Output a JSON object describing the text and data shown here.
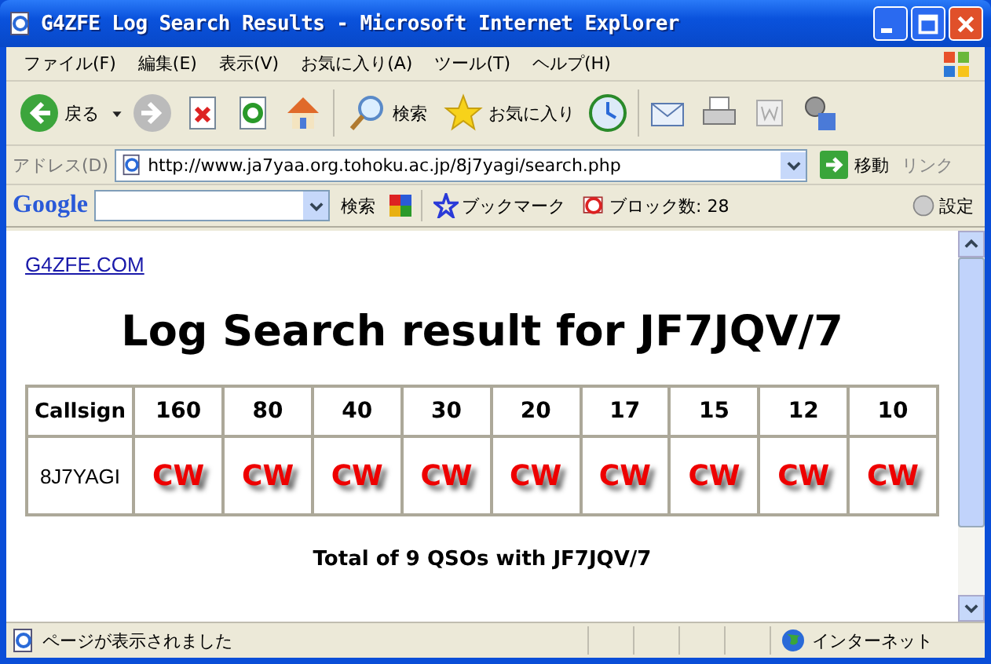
{
  "window": {
    "title": "G4ZFE Log Search Results - Microsoft Internet Explorer"
  },
  "menu": [
    "ファイル(F)",
    "編集(E)",
    "表示(V)",
    "お気に入り(A)",
    "ツール(T)",
    "ヘルプ(H)"
  ],
  "toolbar": {
    "back": "戻る",
    "search": "検索",
    "favorites": "お気に入り"
  },
  "address": {
    "label": "アドレス(D)",
    "url": "http://www.ja7yaa.org.tohoku.ac.jp/8j7yagi/search.php",
    "go": "移動",
    "links": "リンク"
  },
  "google_bar": {
    "logo": "Google",
    "search": "検索",
    "bookmarks": "ブックマーク",
    "blocked": "ブロック数: 28",
    "settings": "設定"
  },
  "page": {
    "link": "G4ZFE.COM",
    "heading": "Log Search result for JF7JQV/7",
    "table": {
      "columns": [
        "Callsign",
        "160",
        "80",
        "40",
        "30",
        "20",
        "17",
        "15",
        "12",
        "10"
      ],
      "rows": [
        {
          "cells": [
            "8J7YAGI",
            "CW",
            "CW",
            "CW",
            "CW",
            "CW",
            "CW",
            "CW",
            "CW",
            "CW"
          ]
        }
      ]
    },
    "total": "Total of 9 QSOs with JF7JQV/7"
  },
  "status_bar": {
    "message": "ページが表示されました",
    "zone": "インターネット"
  }
}
